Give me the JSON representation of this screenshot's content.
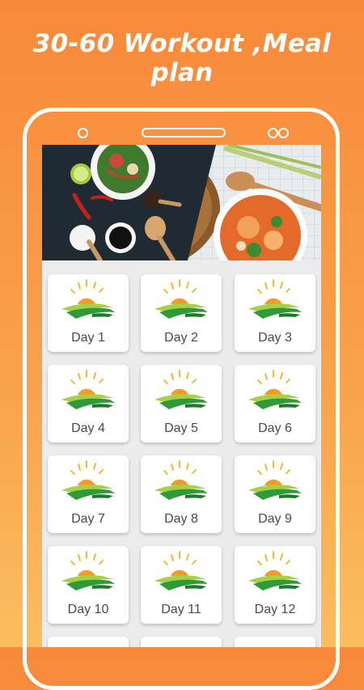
{
  "headline": "30-60 Workout ,Meal plan",
  "days": [
    "Day 1",
    "Day 2",
    "Day 3",
    "Day 4",
    "Day 5",
    "Day 6",
    "Day 7",
    "Day 8",
    "Day 9",
    "Day 10",
    "Day 11",
    "Day 12"
  ],
  "icon": "sunrise-hills-icon",
  "colors": {
    "accent_top": "#f7893a",
    "accent_bottom": "#fbbd5f",
    "sun": "#f59a23",
    "hill": "#2e9a3a"
  }
}
